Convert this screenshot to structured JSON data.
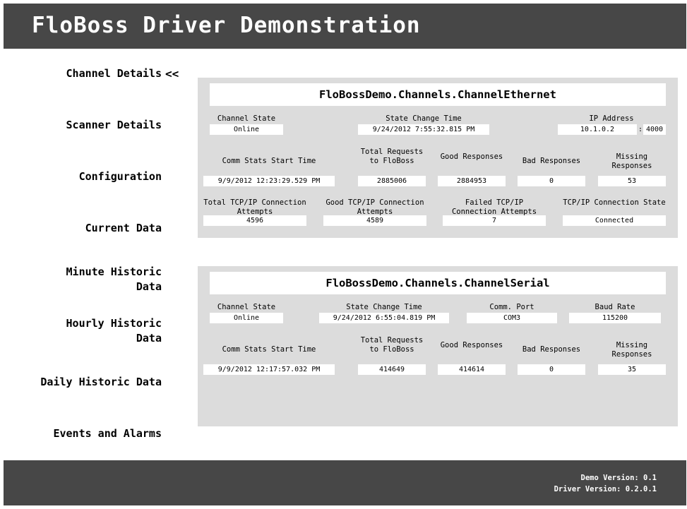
{
  "header": {
    "title": "FloBoss Driver Demonstration"
  },
  "nav": {
    "items": [
      {
        "label": "Channel Details"
      },
      {
        "label": "Scanner Details"
      },
      {
        "label": "Configuration"
      },
      {
        "label": "Current Data"
      },
      {
        "label": "Minute Historic Data",
        "line1": "Minute Historic",
        "line2": "Data"
      },
      {
        "label": "Hourly Historic Data",
        "line1": "Hourly Historic",
        "line2": "Data"
      },
      {
        "label": "Daily Historic Data"
      },
      {
        "label": "Events and Alarms"
      }
    ],
    "active_marker": "<<"
  },
  "ethernet": {
    "title": "FloBossDemo.Channels.ChannelEthernet",
    "channel_state_label": "Channel State",
    "channel_state": "Online",
    "state_change_time_label": "State Change Time",
    "state_change_time": "9/24/2012 7:55:32.815 PM",
    "ip_address_label": "IP Address",
    "ip_address": "10.1.0.2",
    "port": "4000",
    "comm_stats_start_label": "Comm Stats Start Time",
    "comm_stats_start": "9/9/2012 12:23:29.529 PM",
    "total_requests_label": "Total Requests to FloBoss",
    "total_requests": "2885006",
    "good_responses_label": "Good Responses",
    "good_responses": "2884953",
    "bad_responses_label": "Bad Responses",
    "bad_responses": "0",
    "missing_responses_label": "Missing Responses",
    "missing_responses": "53",
    "total_tcp_label": "Total TCP/IP Connection Attempts",
    "total_tcp": "4596",
    "good_tcp_label": "Good TCP/IP Connection Attempts",
    "good_tcp": "4589",
    "failed_tcp_label": "Failed TCP/IP Connection Attempts",
    "failed_tcp": "7",
    "tcp_state_label": "TCP/IP Connection State",
    "tcp_state": "Connected"
  },
  "serial": {
    "title": "FloBossDemo.Channels.ChannelSerial",
    "channel_state_label": "Channel State",
    "channel_state": "Online",
    "state_change_time_label": "State Change Time",
    "state_change_time": "9/24/2012 6:55:04.819 PM",
    "comm_port_label": "Comm. Port",
    "comm_port": "COM3",
    "baud_rate_label": "Baud Rate",
    "baud_rate": "115200",
    "comm_stats_start_label": "Comm Stats Start Time",
    "comm_stats_start": "9/9/2012 12:17:57.032 PM",
    "total_requests_label": "Total Requests to FloBoss",
    "total_requests": "414649",
    "good_responses_label": "Good Responses",
    "good_responses": "414614",
    "bad_responses_label": "Bad Responses",
    "bad_responses": "0",
    "missing_responses_label": "Missing Responses",
    "missing_responses": "35"
  },
  "footer": {
    "demo_version": "Demo Version: 0.1",
    "driver_version": "Driver Version: 0.2.0.1"
  },
  "colors": {
    "bar_background": "#474747",
    "panel_background": "#dcdcdc",
    "field_background": "#ffffff",
    "header_text": "#ffffff"
  }
}
